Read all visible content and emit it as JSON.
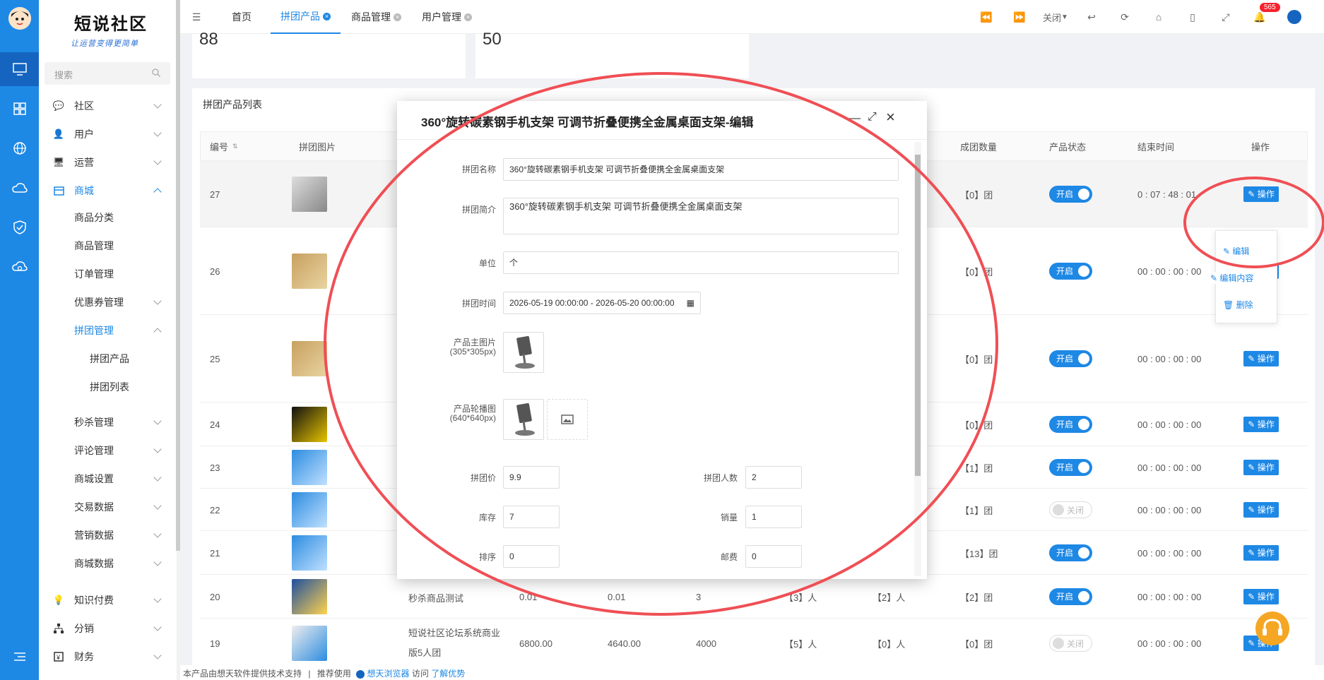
{
  "brand": {
    "title": "短说社区",
    "slogan": "让运营变得更简单"
  },
  "search": {
    "placeholder": "搜索"
  },
  "sidebar": {
    "items": [
      {
        "label": "社区",
        "icon": "chat-icon"
      },
      {
        "label": "用户",
        "icon": "user-icon"
      },
      {
        "label": "运营",
        "icon": "monitor-icon"
      },
      {
        "label": "商城",
        "icon": "shop-icon"
      },
      {
        "label": "商品分类"
      },
      {
        "label": "商品管理"
      },
      {
        "label": "订单管理"
      },
      {
        "label": "优惠券管理"
      },
      {
        "label": "拼团管理"
      },
      {
        "label": "拼团产品"
      },
      {
        "label": "拼团列表"
      },
      {
        "label": "秒杀管理"
      },
      {
        "label": "评论管理"
      },
      {
        "label": "商城设置"
      },
      {
        "label": "交易数据"
      },
      {
        "label": "营销数据"
      },
      {
        "label": "商城数据"
      },
      {
        "label": "知识付费",
        "icon": "bulb-icon"
      },
      {
        "label": "分销",
        "icon": "tree-icon"
      },
      {
        "label": "财务",
        "icon": "finance-icon"
      }
    ]
  },
  "tabs": [
    {
      "label": "首页"
    },
    {
      "label": "拼团产品"
    },
    {
      "label": "商品管理"
    },
    {
      "label": "用户管理"
    }
  ],
  "toolbar": {
    "close_label": "关闭",
    "notif_count": "565"
  },
  "stats": {
    "a": "88",
    "b": "50"
  },
  "list": {
    "title": "拼团产品列表",
    "columns": [
      "编号",
      "拼团图片",
      "成团数量",
      "产品状态",
      "结束时间",
      "操作"
    ],
    "rows": [
      {
        "id": "27",
        "groups": "【0】团",
        "status": "开启",
        "end": "0 : 07 : 48 : 01",
        "op": "操作"
      },
      {
        "id": "26",
        "groups": "【0】团",
        "status": "开启",
        "end": "00 : 00 : 00 : 00",
        "op": "操作"
      },
      {
        "id": "25",
        "groups": "【0】团",
        "status": "开启",
        "end": "00 : 00 : 00 : 00",
        "op": "操作"
      },
      {
        "id": "24",
        "groups": "【0】团",
        "status": "开启",
        "end": "00 : 00 : 00 : 00",
        "op": "操作"
      },
      {
        "id": "23",
        "groups": "【1】团",
        "status": "开启",
        "end": "00 : 00 : 00 : 00",
        "op": "操作"
      },
      {
        "id": "22",
        "groups": "【1】团",
        "status": "关闭",
        "end": "00 : 00 : 00 : 00",
        "op": "操作"
      },
      {
        "id": "21",
        "groups": "【13】团",
        "status": "开启",
        "end": "00 : 00 : 00 : 00",
        "op": "操作"
      },
      {
        "id": "20",
        "name": "秒杀商品测试",
        "price": "0.01",
        "orig": "0.01",
        "stock": "3",
        "people": "【3】人",
        "people2": "【2】人",
        "groups": "【2】团",
        "status": "开启",
        "end": "00 : 00 : 00 : 00",
        "op": "操作"
      },
      {
        "id": "19",
        "name": "短说社区论坛系统商业版5人团",
        "price": "6800.00",
        "orig": "4640.00",
        "stock": "4000",
        "people": "【5】人",
        "people2": "【0】人",
        "groups": "【0】团",
        "status": "关闭",
        "end": "00 : 00 : 00 : 00",
        "op": "操作"
      }
    ]
  },
  "dropdown": {
    "edit": "编辑",
    "edit_content": "编辑内容",
    "delete": "删除"
  },
  "modal": {
    "title": "360°旋转碳素钢手机支架 可调节折叠便携全金属桌面支架-编辑",
    "name_label": "拼团名称",
    "name_value": "360°旋转碳素钢手机支架 可调节折叠便携全金属桌面支架",
    "intro_label": "拼团简介",
    "intro_value": "360°旋转碳素钢手机支架 可调节折叠便携全金属桌面支架",
    "unit_label": "单位",
    "unit_value": "个",
    "time_label": "拼团时间",
    "time_value": "2026-05-19 00:00:00 - 2026-05-20 00:00:00",
    "main_img_label": "产品主图片",
    "main_img_hint": "(305*305px)",
    "carousel_label": "产品轮播图",
    "carousel_hint": "(640*640px)",
    "price_label": "拼团价",
    "price_value": "9.9",
    "people_label": "拼团人数",
    "people_value": "2",
    "stock_label": "库存",
    "stock_value": "7",
    "sales_label": "销量",
    "sales_value": "1",
    "sort_label": "排序",
    "sort_value": "0",
    "postage_label": "邮费",
    "postage_value": "0"
  },
  "footer": {
    "left": "本产品由想天软件提供技术支持",
    "sep": "|",
    "recommend": "推荐使用",
    "browser": "想天浏览器",
    "visit": "访问",
    "link": "了解优势"
  },
  "colors": {
    "primary": "#1e88e5",
    "annotation": "#ef4f55",
    "support": "#f5a623"
  }
}
